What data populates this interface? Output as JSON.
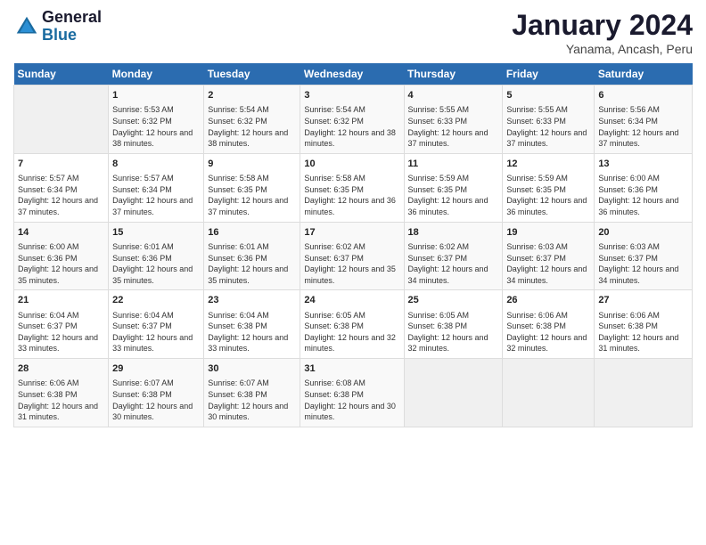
{
  "logo": {
    "line1": "General",
    "line2": "Blue"
  },
  "title": "January 2024",
  "subtitle": "Yanama, Ancash, Peru",
  "days_header": [
    "Sunday",
    "Monday",
    "Tuesday",
    "Wednesday",
    "Thursday",
    "Friday",
    "Saturday"
  ],
  "weeks": [
    [
      {
        "num": "",
        "sunrise": "",
        "sunset": "",
        "daylight": ""
      },
      {
        "num": "1",
        "sunrise": "Sunrise: 5:53 AM",
        "sunset": "Sunset: 6:32 PM",
        "daylight": "Daylight: 12 hours and 38 minutes."
      },
      {
        "num": "2",
        "sunrise": "Sunrise: 5:54 AM",
        "sunset": "Sunset: 6:32 PM",
        "daylight": "Daylight: 12 hours and 38 minutes."
      },
      {
        "num": "3",
        "sunrise": "Sunrise: 5:54 AM",
        "sunset": "Sunset: 6:32 PM",
        "daylight": "Daylight: 12 hours and 38 minutes."
      },
      {
        "num": "4",
        "sunrise": "Sunrise: 5:55 AM",
        "sunset": "Sunset: 6:33 PM",
        "daylight": "Daylight: 12 hours and 37 minutes."
      },
      {
        "num": "5",
        "sunrise": "Sunrise: 5:55 AM",
        "sunset": "Sunset: 6:33 PM",
        "daylight": "Daylight: 12 hours and 37 minutes."
      },
      {
        "num": "6",
        "sunrise": "Sunrise: 5:56 AM",
        "sunset": "Sunset: 6:34 PM",
        "daylight": "Daylight: 12 hours and 37 minutes."
      }
    ],
    [
      {
        "num": "7",
        "sunrise": "Sunrise: 5:57 AM",
        "sunset": "Sunset: 6:34 PM",
        "daylight": "Daylight: 12 hours and 37 minutes."
      },
      {
        "num": "8",
        "sunrise": "Sunrise: 5:57 AM",
        "sunset": "Sunset: 6:34 PM",
        "daylight": "Daylight: 12 hours and 37 minutes."
      },
      {
        "num": "9",
        "sunrise": "Sunrise: 5:58 AM",
        "sunset": "Sunset: 6:35 PM",
        "daylight": "Daylight: 12 hours and 37 minutes."
      },
      {
        "num": "10",
        "sunrise": "Sunrise: 5:58 AM",
        "sunset": "Sunset: 6:35 PM",
        "daylight": "Daylight: 12 hours and 36 minutes."
      },
      {
        "num": "11",
        "sunrise": "Sunrise: 5:59 AM",
        "sunset": "Sunset: 6:35 PM",
        "daylight": "Daylight: 12 hours and 36 minutes."
      },
      {
        "num": "12",
        "sunrise": "Sunrise: 5:59 AM",
        "sunset": "Sunset: 6:35 PM",
        "daylight": "Daylight: 12 hours and 36 minutes."
      },
      {
        "num": "13",
        "sunrise": "Sunrise: 6:00 AM",
        "sunset": "Sunset: 6:36 PM",
        "daylight": "Daylight: 12 hours and 36 minutes."
      }
    ],
    [
      {
        "num": "14",
        "sunrise": "Sunrise: 6:00 AM",
        "sunset": "Sunset: 6:36 PM",
        "daylight": "Daylight: 12 hours and 35 minutes."
      },
      {
        "num": "15",
        "sunrise": "Sunrise: 6:01 AM",
        "sunset": "Sunset: 6:36 PM",
        "daylight": "Daylight: 12 hours and 35 minutes."
      },
      {
        "num": "16",
        "sunrise": "Sunrise: 6:01 AM",
        "sunset": "Sunset: 6:36 PM",
        "daylight": "Daylight: 12 hours and 35 minutes."
      },
      {
        "num": "17",
        "sunrise": "Sunrise: 6:02 AM",
        "sunset": "Sunset: 6:37 PM",
        "daylight": "Daylight: 12 hours and 35 minutes."
      },
      {
        "num": "18",
        "sunrise": "Sunrise: 6:02 AM",
        "sunset": "Sunset: 6:37 PM",
        "daylight": "Daylight: 12 hours and 34 minutes."
      },
      {
        "num": "19",
        "sunrise": "Sunrise: 6:03 AM",
        "sunset": "Sunset: 6:37 PM",
        "daylight": "Daylight: 12 hours and 34 minutes."
      },
      {
        "num": "20",
        "sunrise": "Sunrise: 6:03 AM",
        "sunset": "Sunset: 6:37 PM",
        "daylight": "Daylight: 12 hours and 34 minutes."
      }
    ],
    [
      {
        "num": "21",
        "sunrise": "Sunrise: 6:04 AM",
        "sunset": "Sunset: 6:37 PM",
        "daylight": "Daylight: 12 hours and 33 minutes."
      },
      {
        "num": "22",
        "sunrise": "Sunrise: 6:04 AM",
        "sunset": "Sunset: 6:37 PM",
        "daylight": "Daylight: 12 hours and 33 minutes."
      },
      {
        "num": "23",
        "sunrise": "Sunrise: 6:04 AM",
        "sunset": "Sunset: 6:38 PM",
        "daylight": "Daylight: 12 hours and 33 minutes."
      },
      {
        "num": "24",
        "sunrise": "Sunrise: 6:05 AM",
        "sunset": "Sunset: 6:38 PM",
        "daylight": "Daylight: 12 hours and 32 minutes."
      },
      {
        "num": "25",
        "sunrise": "Sunrise: 6:05 AM",
        "sunset": "Sunset: 6:38 PM",
        "daylight": "Daylight: 12 hours and 32 minutes."
      },
      {
        "num": "26",
        "sunrise": "Sunrise: 6:06 AM",
        "sunset": "Sunset: 6:38 PM",
        "daylight": "Daylight: 12 hours and 32 minutes."
      },
      {
        "num": "27",
        "sunrise": "Sunrise: 6:06 AM",
        "sunset": "Sunset: 6:38 PM",
        "daylight": "Daylight: 12 hours and 31 minutes."
      }
    ],
    [
      {
        "num": "28",
        "sunrise": "Sunrise: 6:06 AM",
        "sunset": "Sunset: 6:38 PM",
        "daylight": "Daylight: 12 hours and 31 minutes."
      },
      {
        "num": "29",
        "sunrise": "Sunrise: 6:07 AM",
        "sunset": "Sunset: 6:38 PM",
        "daylight": "Daylight: 12 hours and 30 minutes."
      },
      {
        "num": "30",
        "sunrise": "Sunrise: 6:07 AM",
        "sunset": "Sunset: 6:38 PM",
        "daylight": "Daylight: 12 hours and 30 minutes."
      },
      {
        "num": "31",
        "sunrise": "Sunrise: 6:08 AM",
        "sunset": "Sunset: 6:38 PM",
        "daylight": "Daylight: 12 hours and 30 minutes."
      },
      {
        "num": "",
        "sunrise": "",
        "sunset": "",
        "daylight": ""
      },
      {
        "num": "",
        "sunrise": "",
        "sunset": "",
        "daylight": ""
      },
      {
        "num": "",
        "sunrise": "",
        "sunset": "",
        "daylight": ""
      }
    ]
  ]
}
